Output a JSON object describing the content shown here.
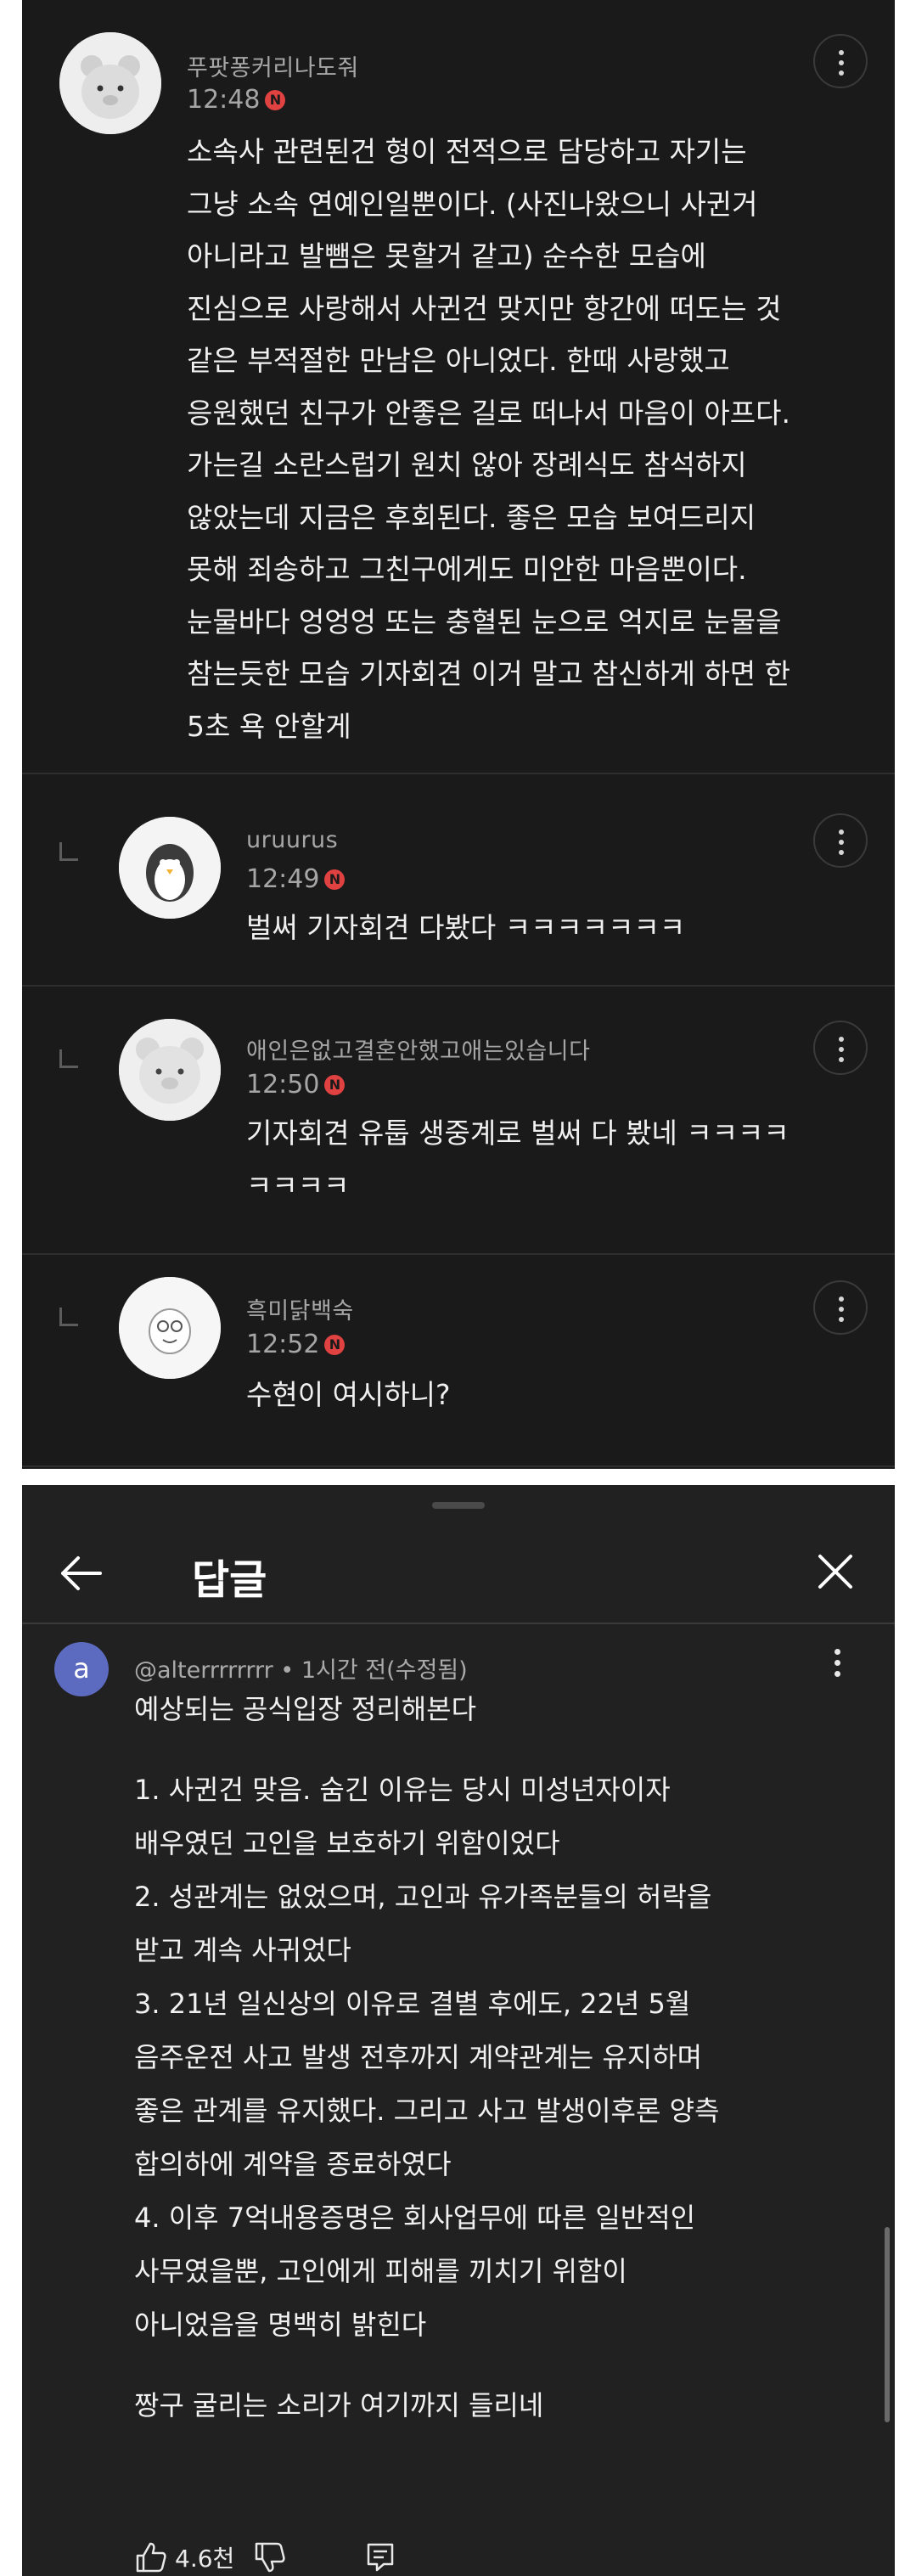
{
  "thread": {
    "main": {
      "username": "푸팟퐁커리나도줘",
      "time": "12:48",
      "badge": "N",
      "avatar_icon": "bear-avatar-icon",
      "lines": [
        "소속사 관련된건 형이 전적으로 담당하고 자기는",
        "그냥 소속 연예인일뿐이다. (사진나왔으니 사귄거",
        "아니라고 발뺌은 못할거 같고) 순수한 모습에",
        "진심으로 사랑해서 사귄건 맞지만 항간에 떠도는 것",
        "같은 부적절한 만남은 아니었다. 한때 사랑했고",
        "응원했던 친구가 안좋은 길로 떠나서 마음이 아프다.",
        "가는길 소란스럽기 원치 않아 장례식도 참석하지",
        "않았는데 지금은 후회된다. 좋은 모습 보여드리지",
        "못해 죄송하고 그친구에게도 미안한 마음뿐이다.",
        "눈물바다 엉엉엉 또는 충혈된 눈으로 억지로 눈물을",
        "참는듯한 모습 기자회견 이거 말고 참신하게 하면 한",
        "5초 욕 안할게"
      ]
    },
    "replies": [
      {
        "username": "uruurus",
        "time": "12:49",
        "badge": "N",
        "avatar_icon": "penguin-avatar-icon",
        "lines": [
          "벌써 기자회견 다봤다 ㅋㅋㅋㅋㅋㅋㅋ"
        ]
      },
      {
        "username": "애인은없고결혼안했고애는있습니다",
        "time": "12:50",
        "badge": "N",
        "avatar_icon": "bear-avatar-icon",
        "lines": [
          "기자회견 유툽 생중계로 벌써 다 봤네 ㅋㅋㅋㅋ",
          "ㅋㅋㅋㅋ"
        ]
      },
      {
        "username": "흑미닭백숙",
        "time": "12:52",
        "badge": "N",
        "avatar_icon": "cartoon-avatar-icon",
        "lines": [
          "수현이 여시하니?"
        ]
      }
    ]
  },
  "reply_sheet": {
    "title": "답글",
    "back_icon": "back-arrow-icon",
    "close_icon": "close-icon",
    "avatar_letter": "a",
    "meta": "@alterrrrrrrr • 1시간 전(수정됨)",
    "lines": [
      "예상되는 공식입장 정리해본다",
      "",
      "1. 사귄건 맞음. 숨긴 이유는 당시 미성년자이자",
      "배우였던 고인을 보호하기 위함이었다",
      "2. 성관계는 없었으며, 고인과 유가족분들의 허락을",
      "받고 계속 사귀었다",
      "3. 21년 일신상의 이유로 결별 후에도, 22년 5월",
      "음주운전 사고 발생 전후까지 계약관계는 유지하며",
      "좋은 관계를 유지했다. 그리고 사고 발생이후론 양측",
      "합의하에 계약을 종료하였다",
      "4. 이후 7억내용증명은 회사업무에 따른 일반적인",
      "사무였을뿐, 고인에게 피해를 끼치기 위함이",
      "아니었음을 명백히 밝힌다",
      "",
      "짱구 굴리는 소리가 여기까지 들리네"
    ],
    "like_count": "4.6천",
    "like_icon": "thumbs-up-icon",
    "dislike_icon": "thumbs-down-icon",
    "reply_icon": "comment-icon"
  }
}
